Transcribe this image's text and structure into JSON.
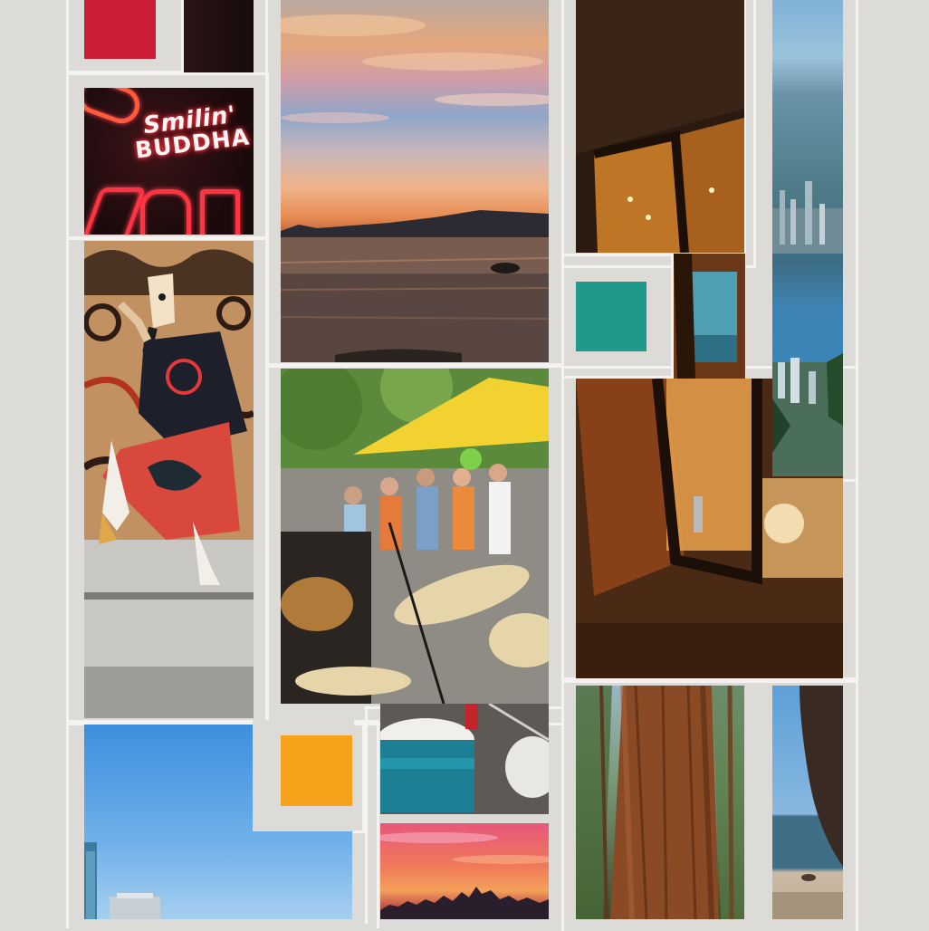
{
  "neon_sign": {
    "line1": "Smilin'",
    "line2": "BUDDHA"
  },
  "colors": {
    "background": "#dcdbd8",
    "frame": "#f4f3f1",
    "accent_red": "#cb1d36",
    "accent_teal": "#1e998a",
    "accent_orange": "#f7a21b"
  },
  "photos": [
    "neon-sign-photo",
    "sunset-ocean-photo",
    "indigenous-dancer-photo",
    "street-festival-band-photo",
    "city-skyline-photo",
    "sunset-skyline-photo",
    "restaurant-window-photo",
    "aerial-city-coast-photo",
    "giant-redwood-photo",
    "beach-sculpture-photo"
  ]
}
